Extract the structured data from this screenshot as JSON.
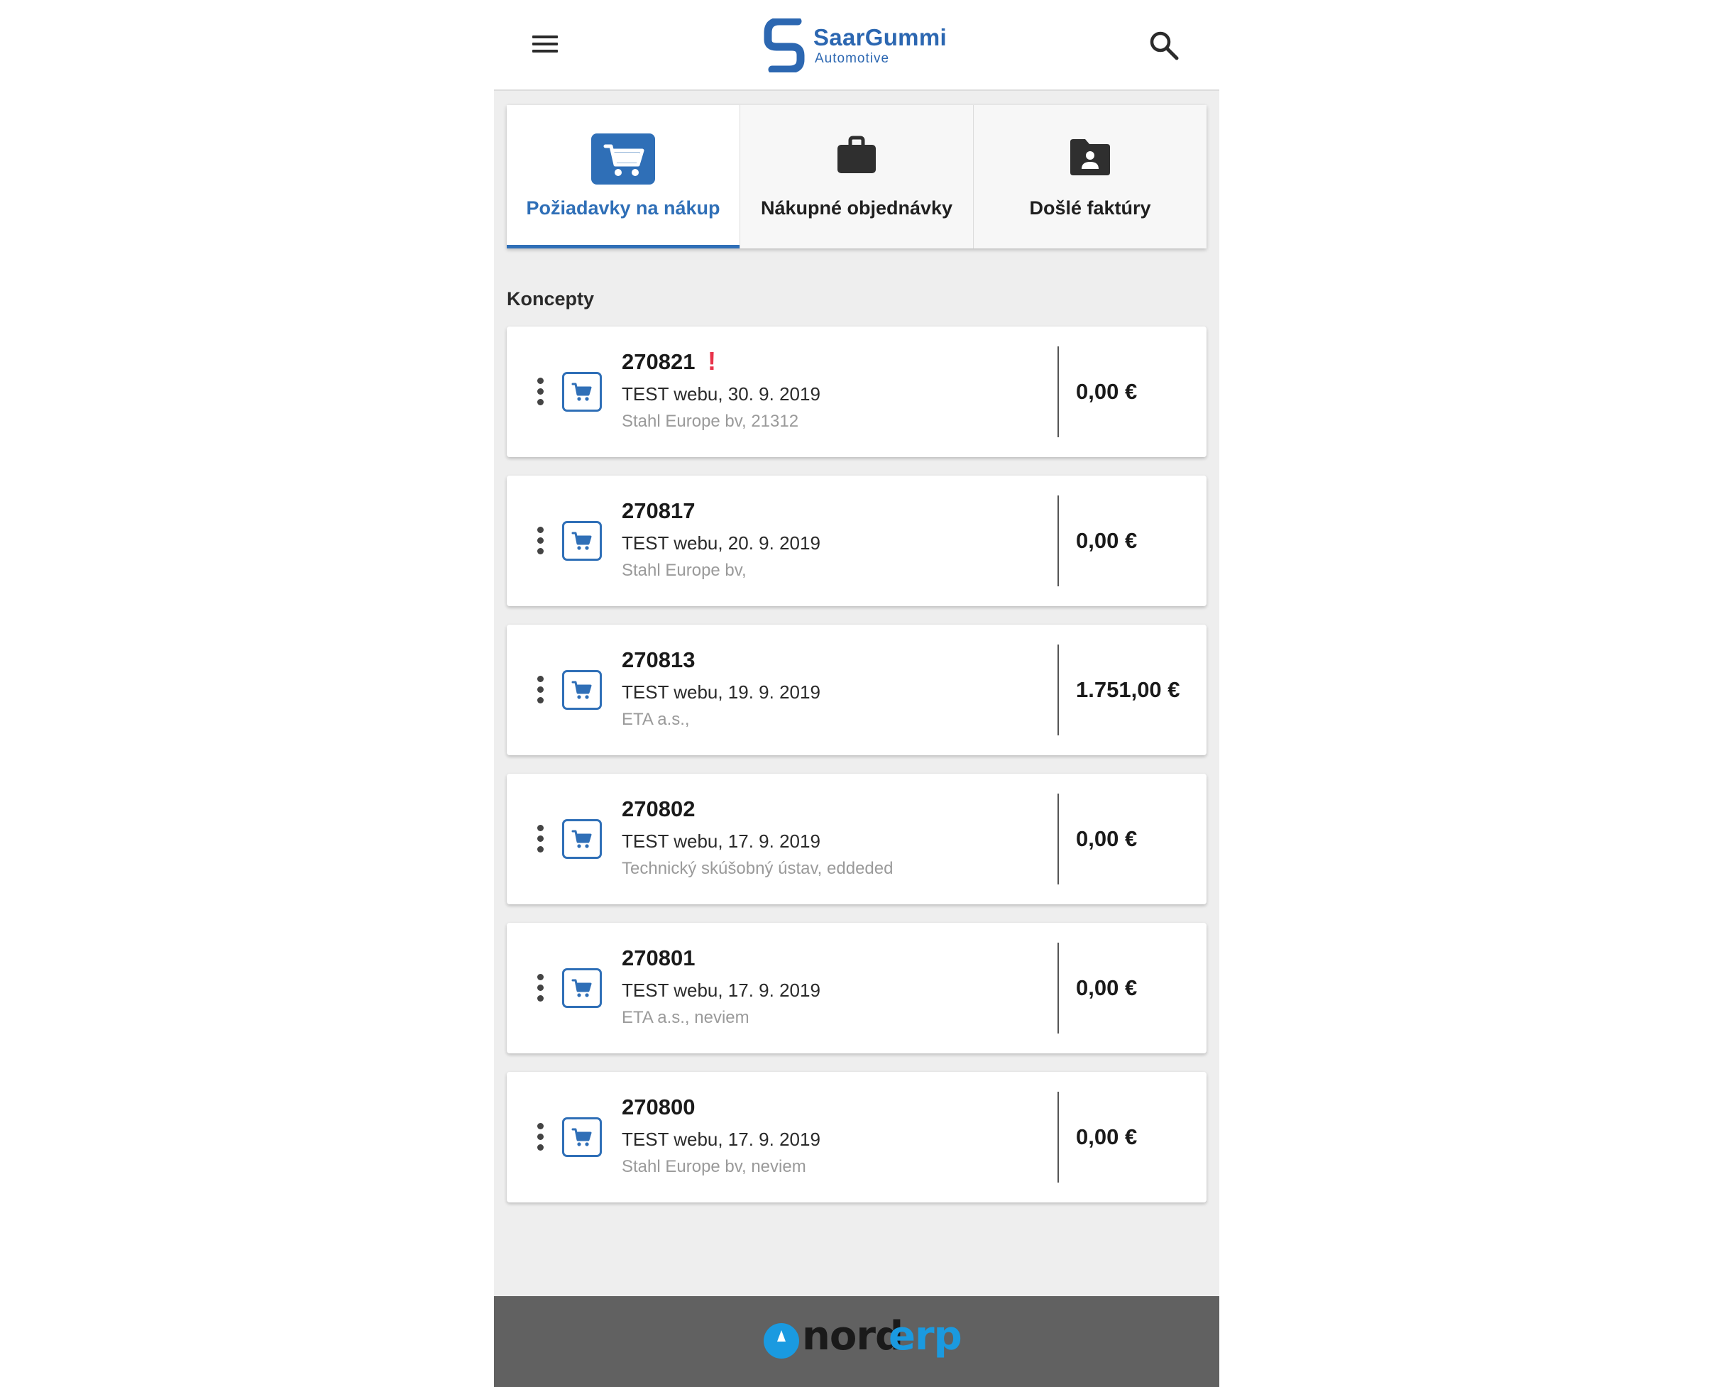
{
  "header": {
    "menu_icon": "hamburger-menu-icon",
    "search_icon": "search-icon",
    "logo": {
      "brand": "SaarGummi",
      "sub": "Automotive",
      "color": "#2c67b1"
    }
  },
  "tabs": [
    {
      "label": "Požiadavky na nákup",
      "icon": "shopping-cart-icon",
      "active": true
    },
    {
      "label": "Nákupné objednávky",
      "icon": "briefcase-icon",
      "active": false
    },
    {
      "label": "Došlé faktúry",
      "icon": "folder-user-icon",
      "active": false
    }
  ],
  "section": {
    "title": "Koncepty"
  },
  "requests": [
    {
      "number": "270821",
      "alert": "!",
      "description": "TEST webu, 30. 9. 2019",
      "vendor": "Stahl Europe bv, 21312",
      "amount": "0,00 €"
    },
    {
      "number": "270817",
      "alert": "",
      "description": "TEST webu, 20. 9. 2019",
      "vendor": "Stahl Europe bv,",
      "amount": "0,00 €"
    },
    {
      "number": "270813",
      "alert": "",
      "description": "TEST webu, 19. 9. 2019",
      "vendor": "ETA a.s.,",
      "amount": "1.751,00 €"
    },
    {
      "number": "270802",
      "alert": "",
      "description": "TEST webu, 17. 9. 2019",
      "vendor": "Technický skúšobný ústav, eddeded",
      "amount": "0,00 €"
    },
    {
      "number": "270801",
      "alert": "",
      "description": "TEST webu, 17. 9. 2019",
      "vendor": "ETA a.s., neviem",
      "amount": "0,00 €"
    },
    {
      "number": "270800",
      "alert": "",
      "description": "TEST webu, 17. 9. 2019",
      "vendor": "Stahl Europe bv, neviem",
      "amount": "0,00 €"
    }
  ],
  "footer": {
    "brand_part1": "nord",
    "brand_part2": "erp"
  },
  "colors": {
    "accent": "#2f6fb7",
    "alert": "#e8334a",
    "footer_bg": "#616161",
    "footer_brand": "#1a9ae0"
  }
}
